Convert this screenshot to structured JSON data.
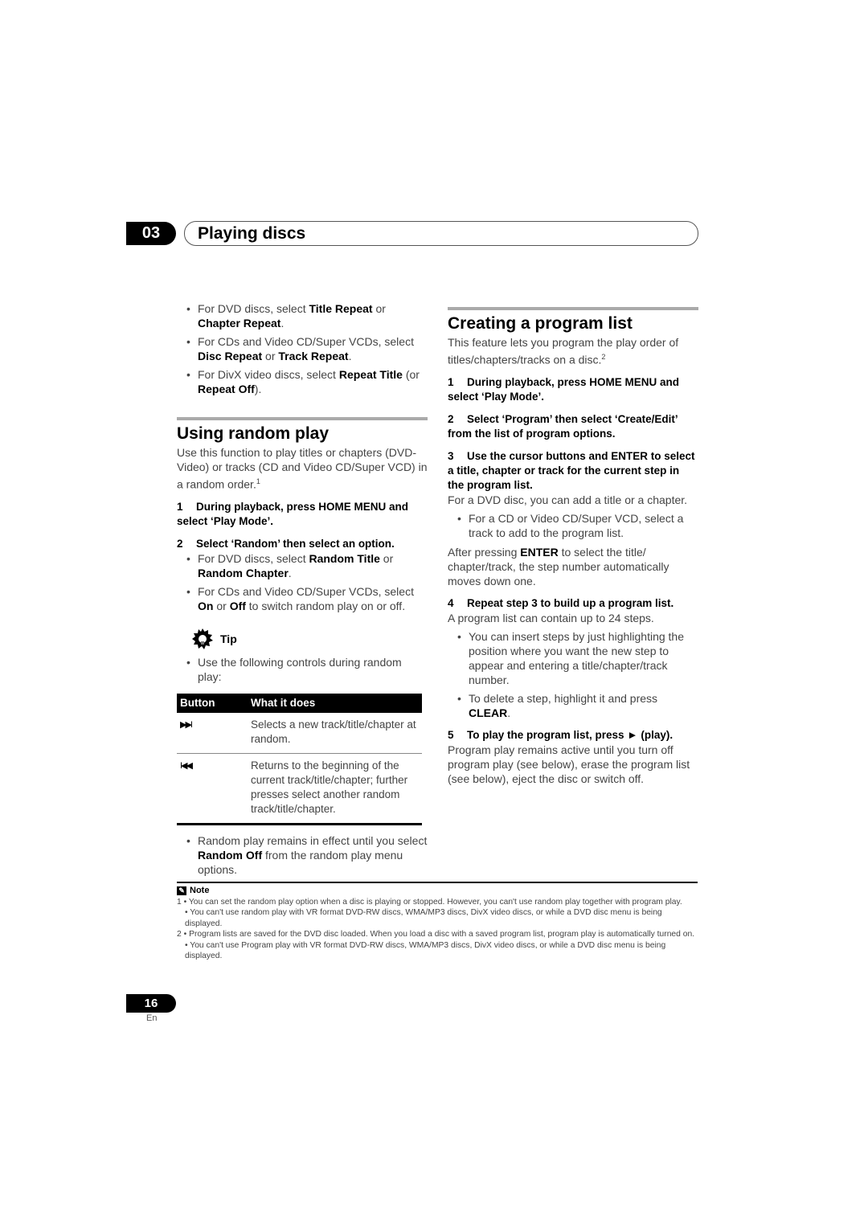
{
  "header": {
    "chapter_number": "03",
    "chapter_title": "Playing discs"
  },
  "left": {
    "repeat_bullets": [
      {
        "pre": "For DVD discs, select ",
        "b1": "Title Repeat",
        "mid": " or ",
        "b2": "Chapter Repeat",
        "post": "."
      },
      {
        "pre": "For CDs and Video CD/Super VCDs, select ",
        "b1": "Disc Repeat",
        "mid": " or ",
        "b2": "Track Repeat",
        "post": "."
      },
      {
        "pre": "For DivX video discs, select ",
        "b1": "Repeat Title",
        "mid": " (or ",
        "b2": "Repeat Off",
        "post": ")."
      }
    ],
    "section_title": "Using random play",
    "intro": "Use this function to play titles or chapters (DVD-Video) or tracks (CD and Video CD/Super VCD) in a random order.",
    "intro_footnote": "1",
    "step1": {
      "num": "1",
      "text": "During playback, press HOME MENU and select ‘Play Mode’."
    },
    "step2": {
      "num": "2",
      "text": "Select ‘Random’ then select an option."
    },
    "step2_bullets": [
      {
        "pre": "For DVD discs, select ",
        "b1": "Random Title",
        "mid": " or ",
        "b2": "Random Chapter",
        "post": "."
      },
      {
        "pre": "For CDs and Video CD/Super VCDs, select ",
        "b1": "On",
        "mid": " or ",
        "b2": "Off",
        "post": " to switch random play on or off."
      }
    ],
    "tip_label": "Tip",
    "tip_bullet": "Use the following controls during random play:",
    "table": {
      "headers": [
        "Button",
        "What it does"
      ],
      "rows": [
        {
          "icon": "▶▶I",
          "icon_name": "next-track-icon",
          "desc": "Selects a new track/title/chapter at random."
        },
        {
          "icon": "I◀◀",
          "icon_name": "previous-track-icon",
          "desc": "Returns to the beginning of the current track/title/chapter; further presses select another random track/title/chapter."
        }
      ]
    },
    "final_bullet": {
      "pre": "Random play remains in effect until you select ",
      "b1": "Random Off",
      "post": " from the random play menu options."
    }
  },
  "right": {
    "section_title": "Creating a program list",
    "intro": "This feature lets you program the play order of titles/chapters/tracks on a disc.",
    "intro_footnote": "2",
    "step1": {
      "num": "1",
      "text": "During playback, press HOME MENU and select ‘Play Mode’."
    },
    "step2": {
      "num": "2",
      "text": "Select ‘Program’ then select ‘Create/Edit’ from the list of program options."
    },
    "step3": {
      "num": "3",
      "text": "Use the cursor buttons and ENTER to select a title, chapter or track for the current step in the program list."
    },
    "step3_body": "For a DVD disc, you can add a title or a chapter.",
    "step3_bullet": "For a CD or Video CD/Super VCD, select a track to add to the program list.",
    "after_enter": {
      "pre": "After pressing ",
      "b1": "ENTER",
      "post": " to select the title/ chapter/track, the step number automatically moves down one."
    },
    "step4": {
      "num": "4",
      "text": "Repeat step 3 to build up a program list."
    },
    "step4_body": "A program list can contain up to 24 steps.",
    "step4_bullets": [
      {
        "pre": "You can insert steps by just highlighting the position where you want the new step to appear and entering a title/chapter/track number.",
        "b1": "",
        "post": ""
      },
      {
        "pre": "To delete a step, highlight it and press ",
        "b1": "CLEAR",
        "post": "."
      }
    ],
    "step5": {
      "num": "5",
      "text": "To play the program list, press ► (play)."
    },
    "step5_body": "Program play remains active until you turn off program play (see below), erase the program list (see below), eject the disc or switch off."
  },
  "notes": {
    "label": "Note",
    "items": [
      {
        "num": "1",
        "lines": [
          "• You can set the random play option when a disc is playing or stopped. However, you can't use random play together with program play.",
          "• You can't use random play with VR format DVD-RW discs, WMA/MP3 discs, DivX video discs, or while a DVD disc menu is being displayed."
        ]
      },
      {
        "num": "2",
        "lines": [
          "• Program lists are saved for the DVD disc loaded. When you load a disc with a saved program list, program play is automatically turned on.",
          "• You can't use Program play with VR format DVD-RW discs, WMA/MP3 discs, DivX video discs, or while a DVD disc menu is being displayed."
        ]
      }
    ]
  },
  "footer": {
    "page_number": "16",
    "language": "En"
  }
}
